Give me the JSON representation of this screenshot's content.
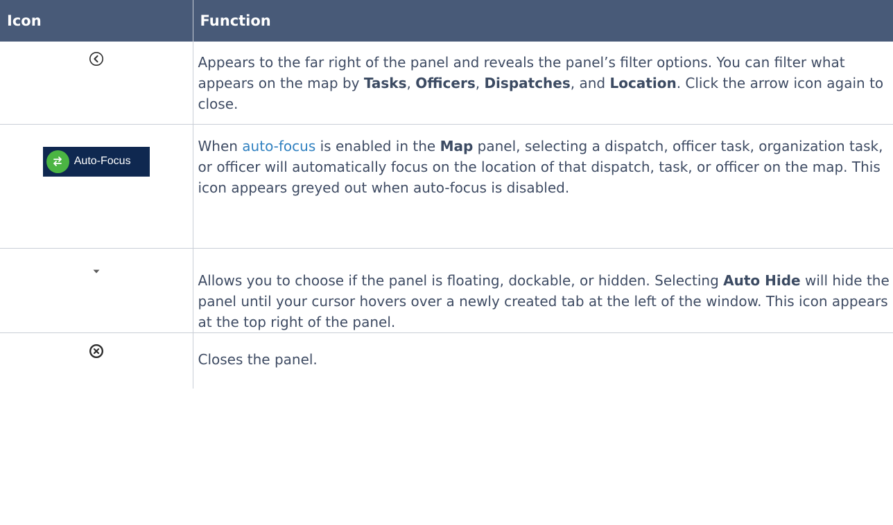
{
  "table": {
    "headers": [
      "Icon",
      "Function"
    ],
    "rows": [
      {
        "icon": "chevron-left-circle-icon",
        "text": [
          "Appears to the far right of the panel and reveals the panel’s filter options. You can filter what appears on the map by ",
          "Tasks",
          ", ",
          "Officers",
          ", ",
          "Dispatches",
          ", and ",
          "Location",
          ". Click the arrow icon again to close."
        ]
      },
      {
        "icon": "auto-focus-icon",
        "badge_label": "Auto-Focus",
        "text": [
          "When ",
          "auto-focus",
          " is enabled in the ",
          "Map",
          " panel, selecting a dispatch, officer task, organization task, or officer will automatically focus on the location of that dispatch, task, or officer on the map. This icon appears greyed out when auto-focus is disabled."
        ]
      },
      {
        "icon": "dropdown-arrow-icon",
        "text": [
          "Allows you to choose if the panel is floating, dockable, or hidden. Selecting ",
          "Auto Hide",
          " will hide the panel until your cursor hovers over a newly created tab at the left of the window. This icon appears at the top right of the panel."
        ]
      },
      {
        "icon": "close-circle-icon",
        "text": [
          "Closes the panel."
        ]
      }
    ]
  },
  "colors": {
    "header_bg": "#485a78",
    "text": "#3e4b63",
    "link": "#2f80c0",
    "badge_bg": "#0f2850",
    "badge_circle": "#4bb543"
  }
}
